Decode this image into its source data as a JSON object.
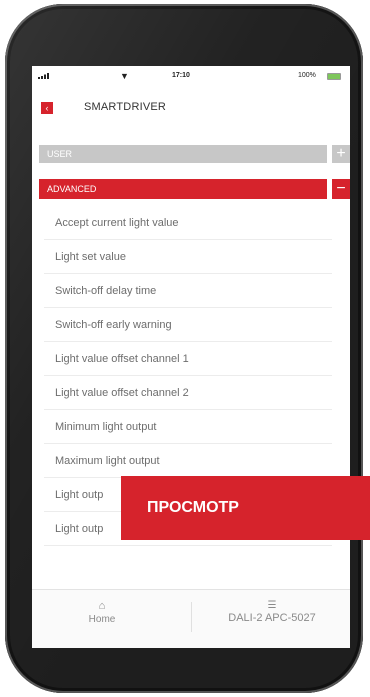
{
  "status_bar": {
    "time": "17:10",
    "battery": "100%",
    "signal_icon": "signal-icon",
    "wifi_icon": "wifi-icon",
    "battery_icon": "battery-icon"
  },
  "header": {
    "title": "SMARTDRIVER",
    "back_icon": "back-arrow-icon",
    "accent_color": "#d6232c"
  },
  "sections": {
    "user": {
      "label": "USER",
      "toggle": "+"
    },
    "advanced": {
      "label": "ADVANCED",
      "toggle": "−"
    }
  },
  "list_items": [
    "Accept current light value",
    "Light set value",
    "Switch-off delay time",
    "Switch-off early warning",
    "Light value offset channel 1",
    "Light value offset channel 2",
    "Minimum light output",
    "Maximum light output",
    "Light outp",
    "Light outp"
  ],
  "tabbar": {
    "home": {
      "label": "Home",
      "icon": "home-icon"
    },
    "device": {
      "label": "DALI-2 APC-5027",
      "icon": "sliders-icon"
    }
  },
  "overlay": {
    "label": "ПРОСМОТР"
  }
}
